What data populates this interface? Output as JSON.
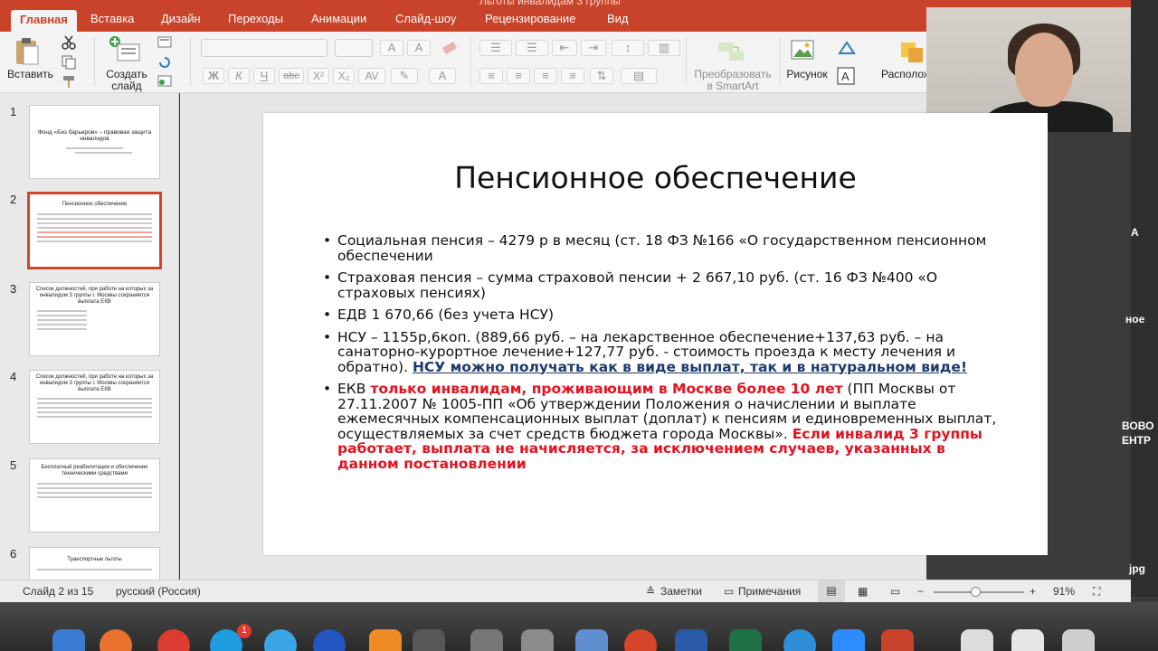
{
  "window": {
    "title": "Льготы инвалидам 3 группы"
  },
  "ribbon": {
    "tabs": [
      {
        "label": "Главная",
        "active": true
      },
      {
        "label": "Вставка"
      },
      {
        "label": "Дизайн"
      },
      {
        "label": "Переходы"
      },
      {
        "label": "Анимации"
      },
      {
        "label": "Слайд-шоу"
      },
      {
        "label": "Рецензирование"
      },
      {
        "label": "Вид"
      }
    ],
    "paste_label": "Вставить",
    "new_slide_label": "Создать\nслайд",
    "smartart_label": "Преобразовать\nв SmartArt",
    "picture_label": "Рисунок",
    "arrange_label": "Располож",
    "font_buttons": [
      "Ж",
      "К",
      "Ч",
      "abc",
      "X²",
      "X₂",
      "A"
    ]
  },
  "desktop_labels": [
    "А",
    "ное",
    "ВОВО",
    "ЕНТР",
    "jpg"
  ],
  "thumbnails": [
    {
      "num": "1",
      "title": "Фонд «Без барьеров» – правовая защита инвалидов"
    },
    {
      "num": "2",
      "title": "Пенсионное обеспечение"
    },
    {
      "num": "3",
      "title": "Список должностей, при работе на которых за инвалидом 3 группы г. Москвы сохраняется выплата ЕКВ"
    },
    {
      "num": "4",
      "title": "Список должностей, при работе на которых за инвалидом 3 группы г. Москвы сохраняется выплата ЕКВ"
    },
    {
      "num": "5",
      "title": "Бесплатный реабилитация и обеспечение техническими средствами"
    },
    {
      "num": "6",
      "title": "Транспортные льготы"
    }
  ],
  "slide": {
    "title": "Пенсионное обеспечение",
    "b1": "Социальная пенсия  – 4279 р в месяц (ст. 18 ФЗ №166 «О государственном пенсионном обеспечении",
    "b2": "Страховая пенсия – сумма страховой пенсии + 2 667,10 руб. (ст. 16 ФЗ №400 «О страховых пенсиях)",
    "b3": "ЕДВ 1 670,66 (без учета НСУ)",
    "b4_text": "НСУ – 1155р,6коп. (889,66 руб. – на лекарственное обеспечение+137,63 руб. – на санаторно-курортное лечение+127,77 руб. - стоимость проезда к месту лечения и обратно). ",
    "b4_link": "НСУ можно получать как в виде выплат, так и в натуральном виде!",
    "b5_a": "ЕКВ ",
    "b5_red1": "только инвалидам, проживающим в Москве более 10 лет",
    "b5_b": " (ПП Москвы от 27.11.2007 № 1005-ПП «Об утверждении Положения о начислении и выплате ежемесячных компенсационных выплат (доплат)  к пенсиям и единовременных выплат, осуществляемых за счет средств бюджета города Москвы». ",
    "b5_red2": "Если инвалид 3 группы работает, выплата не начисляется, за исключением случаев, указанных в данном постановлении"
  },
  "status": {
    "slide_counter": "Слайд 2 из 15",
    "language": "русский (Россия)",
    "notes": "Заметки",
    "comments": "Примечания",
    "zoom": "91%"
  }
}
